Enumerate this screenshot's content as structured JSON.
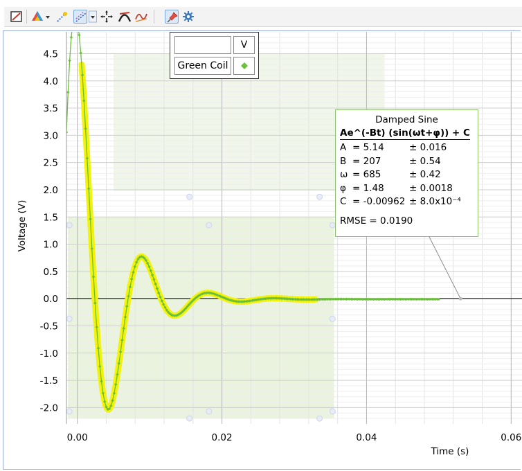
{
  "toolbar": {
    "buttons": [
      {
        "name": "graph-options-icon"
      },
      {
        "name": "data-browser-icon"
      },
      {
        "name": "dropdown-arrow-icon"
      },
      {
        "name": "examine-icon"
      },
      {
        "name": "selection-icon"
      },
      {
        "name": "dropdown-arrow-icon"
      },
      {
        "name": "crosshair-icon"
      },
      {
        "name": "tangent-icon"
      },
      {
        "name": "curve-fit-icon"
      },
      {
        "name": "pin-icon"
      },
      {
        "name": "settings-gear-icon"
      }
    ]
  },
  "legend": {
    "unit_label": "V",
    "series_label": "Green Coil",
    "swatch_color": "#6bbf3a"
  },
  "fit": {
    "title": "Damped Sine",
    "equation": "Ae^(-Bt) (sin(ωt+φ)) + C",
    "params": [
      {
        "name": "A",
        "value": "= 5.14",
        "error": "± 0.016"
      },
      {
        "name": "B",
        "value": "= 207",
        "error": "± 0.54"
      },
      {
        "name": "ω",
        "value": "= 685",
        "error": "± 0.42"
      },
      {
        "name": "φ",
        "value": "= 1.48",
        "error": "± 0.0018"
      },
      {
        "name": "C",
        "value": "= -0.00962",
        "error": "± 8.0x10⁻⁴"
      }
    ],
    "rmse": "RMSE = 0.0190"
  },
  "chart_data": {
    "type": "scatter",
    "xlabel": "Time (s)",
    "ylabel": "Voltage (V)",
    "xlim": [
      -0.0015,
      0.0615
    ],
    "ylim": [
      -2.3,
      4.9
    ],
    "x_ticks": [
      "0.00",
      "0.02",
      "0.04",
      "0.06"
    ],
    "y_ticks": [
      "4.5",
      "4.0",
      "3.5",
      "3.0",
      "2.5",
      "2.0",
      "1.5",
      "1.0",
      "0.5",
      "0.0",
      "-0.5",
      "-1.0",
      "-1.5",
      "-2.0"
    ],
    "grid": true,
    "legend_position": "top-center",
    "series": [
      {
        "name": "Green Coil",
        "color": "#6bbf3a",
        "t_range": [
          -0.0015,
          0.05
        ],
        "sample_step": 0.00022,
        "model": {
          "A": 5.14,
          "B": 207,
          "omega": 685,
          "phi": 1.48,
          "C": -0.00962
        }
      }
    ],
    "fit": {
      "name": "Damped Sine",
      "color": "#f2f20a",
      "x_range": [
        0.0006,
        0.033
      ],
      "model": {
        "A": 5.14,
        "B": 207,
        "omega": 685,
        "phi": 1.48,
        "C": -0.00962
      }
    },
    "selection": {
      "x_range": [
        -0.0013,
        0.0355
      ],
      "y_range": [
        -2.2,
        1.5
      ],
      "fill": "#e9f3dd"
    },
    "selection_background": {
      "x_range": [
        0.005,
        0.0425
      ],
      "y_range": [
        1.98,
        4.5
      ],
      "fill": "#f0f6ea"
    }
  }
}
